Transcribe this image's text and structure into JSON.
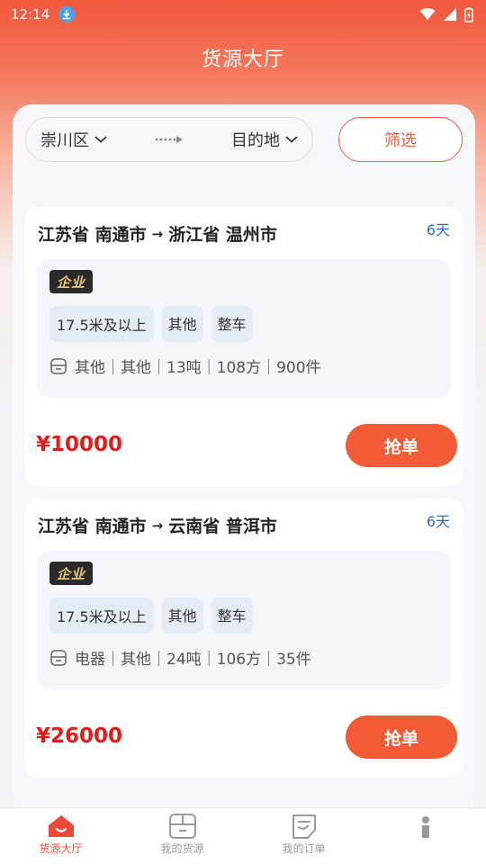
{
  "status": {
    "time": "12:14"
  },
  "app": {
    "title": "货源大厅"
  },
  "filter": {
    "origin": "崇川区",
    "destination": "目的地",
    "filter_label": "筛选"
  },
  "cards": [
    {
      "from": "江苏省 南通市",
      "arrow": "→",
      "to": "浙江省 温州市",
      "days": "6天",
      "badge": "企业",
      "tags": [
        "17.5米及以上",
        "其他",
        "整车"
      ],
      "specs": "其他｜其他｜13吨｜108方｜900件",
      "price": "¥10000",
      "action": "抢单"
    },
    {
      "from": "江苏省 南通市",
      "arrow": "→",
      "to": "云南省 普洱市",
      "days": "6天",
      "badge": "企业",
      "tags": [
        "17.5米及以上",
        "其他",
        "整车"
      ],
      "specs": "电器｜其他｜24吨｜106方｜35件",
      "price": "¥26000",
      "action": "抢单"
    }
  ],
  "tabs": [
    {
      "label": "货源大厅",
      "icon": "home-icon",
      "active": true
    },
    {
      "label": "我的货源",
      "icon": "box-icon",
      "active": false
    },
    {
      "label": "我的订单",
      "icon": "order-icon",
      "active": false
    },
    {
      "label": "",
      "icon": "profile-icon",
      "active": false
    }
  ],
  "colors": {
    "accent": "#f35a36",
    "price": "#e21b1b",
    "days": "#2b6cd0"
  }
}
